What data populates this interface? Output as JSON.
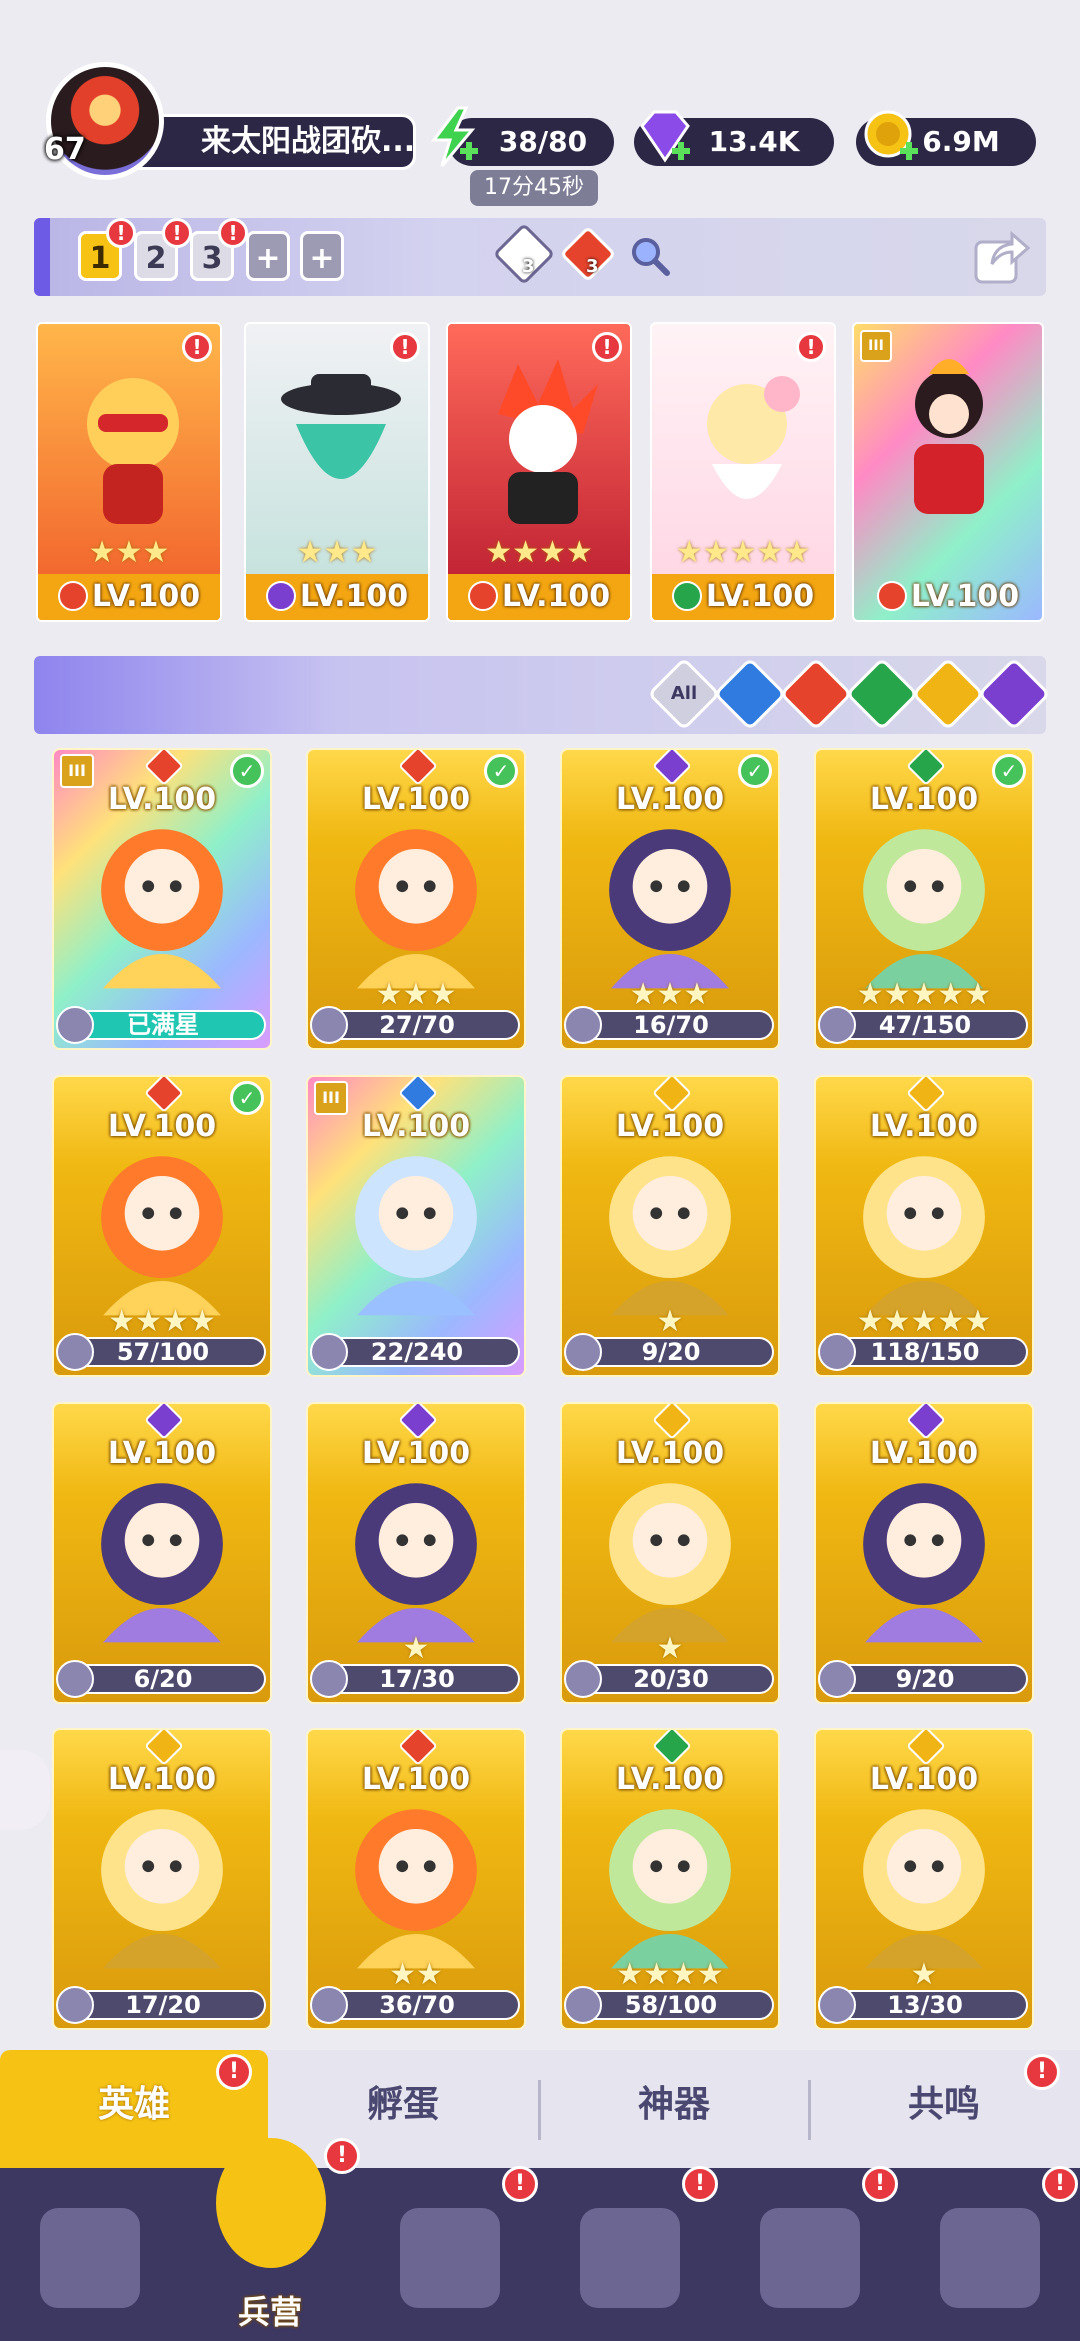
{
  "player": {
    "level": "67",
    "name": "来太阳战团砍..."
  },
  "resources": {
    "energy": "38/80",
    "energy_timer": "17分45秒",
    "gems": "13.4K",
    "gold": "6.9M"
  },
  "teams": {
    "tabs": [
      "1",
      "2",
      "3",
      "+",
      "+"
    ],
    "active": "1"
  },
  "team_counts": {
    "light": "3",
    "fire": "3"
  },
  "lineup": [
    {
      "level": "LV.100",
      "element": "fire",
      "stars": "★★★"
    },
    {
      "level": "LV.100",
      "element": "dark",
      "stars": "★★★"
    },
    {
      "level": "LV.100",
      "element": "fire",
      "stars": "★★★★"
    },
    {
      "level": "LV.100",
      "element": "nature",
      "stars": "★★★★★"
    },
    {
      "level": "LV.100",
      "element": "fire",
      "stars": ""
    }
  ],
  "filters": [
    "All",
    "water",
    "fire",
    "nature",
    "light",
    "dark"
  ],
  "filter_all_label": "All",
  "heroes": [
    {
      "level": "LV.100",
      "progress": "已满星",
      "element": "fire",
      "stars": "",
      "checked": true,
      "rank": "III",
      "rainbow": true
    },
    {
      "level": "LV.100",
      "progress": "27/70",
      "element": "fire",
      "stars": "★★★",
      "checked": true
    },
    {
      "level": "LV.100",
      "progress": "16/70",
      "element": "dark",
      "stars": "★★★",
      "checked": true
    },
    {
      "level": "LV.100",
      "progress": "47/150",
      "element": "nature",
      "stars": "★★★★★",
      "checked": true
    },
    {
      "level": "LV.100",
      "progress": "57/100",
      "element": "fire",
      "stars": "★★★★",
      "checked": true
    },
    {
      "level": "LV.100",
      "progress": "22/240",
      "element": "water",
      "stars": "",
      "rank": "III",
      "rainbow": true
    },
    {
      "level": "LV.100",
      "progress": "9/20",
      "element": "light",
      "stars": "★"
    },
    {
      "level": "LV.100",
      "progress": "118/150",
      "element": "light",
      "stars": "★★★★★"
    },
    {
      "level": "LV.100",
      "progress": "6/20",
      "element": "dark",
      "stars": ""
    },
    {
      "level": "LV.100",
      "progress": "17/30",
      "element": "dark",
      "stars": "★"
    },
    {
      "level": "LV.100",
      "progress": "20/30",
      "element": "light",
      "stars": "★"
    },
    {
      "level": "LV.100",
      "progress": "9/20",
      "element": "dark",
      "stars": ""
    },
    {
      "level": "LV.100",
      "progress": "17/20",
      "element": "light",
      "stars": ""
    },
    {
      "level": "LV.100",
      "progress": "36/70",
      "element": "fire",
      "stars": "★★"
    },
    {
      "level": "LV.100",
      "progress": "58/100",
      "element": "nature",
      "stars": "★★★★"
    },
    {
      "level": "LV.100",
      "progress": "13/30",
      "element": "light",
      "stars": "★"
    }
  ],
  "subtabs": [
    "英雄",
    "孵蛋",
    "神器",
    "共鸣"
  ],
  "nav": {
    "barracks_label": "兵营"
  },
  "colors": {
    "fire": "#e5432c",
    "dark": "#7b3fd0",
    "nature": "#27a54a",
    "water": "#2f7be0",
    "light": "#f0b414",
    "accent": "#f6c315"
  }
}
